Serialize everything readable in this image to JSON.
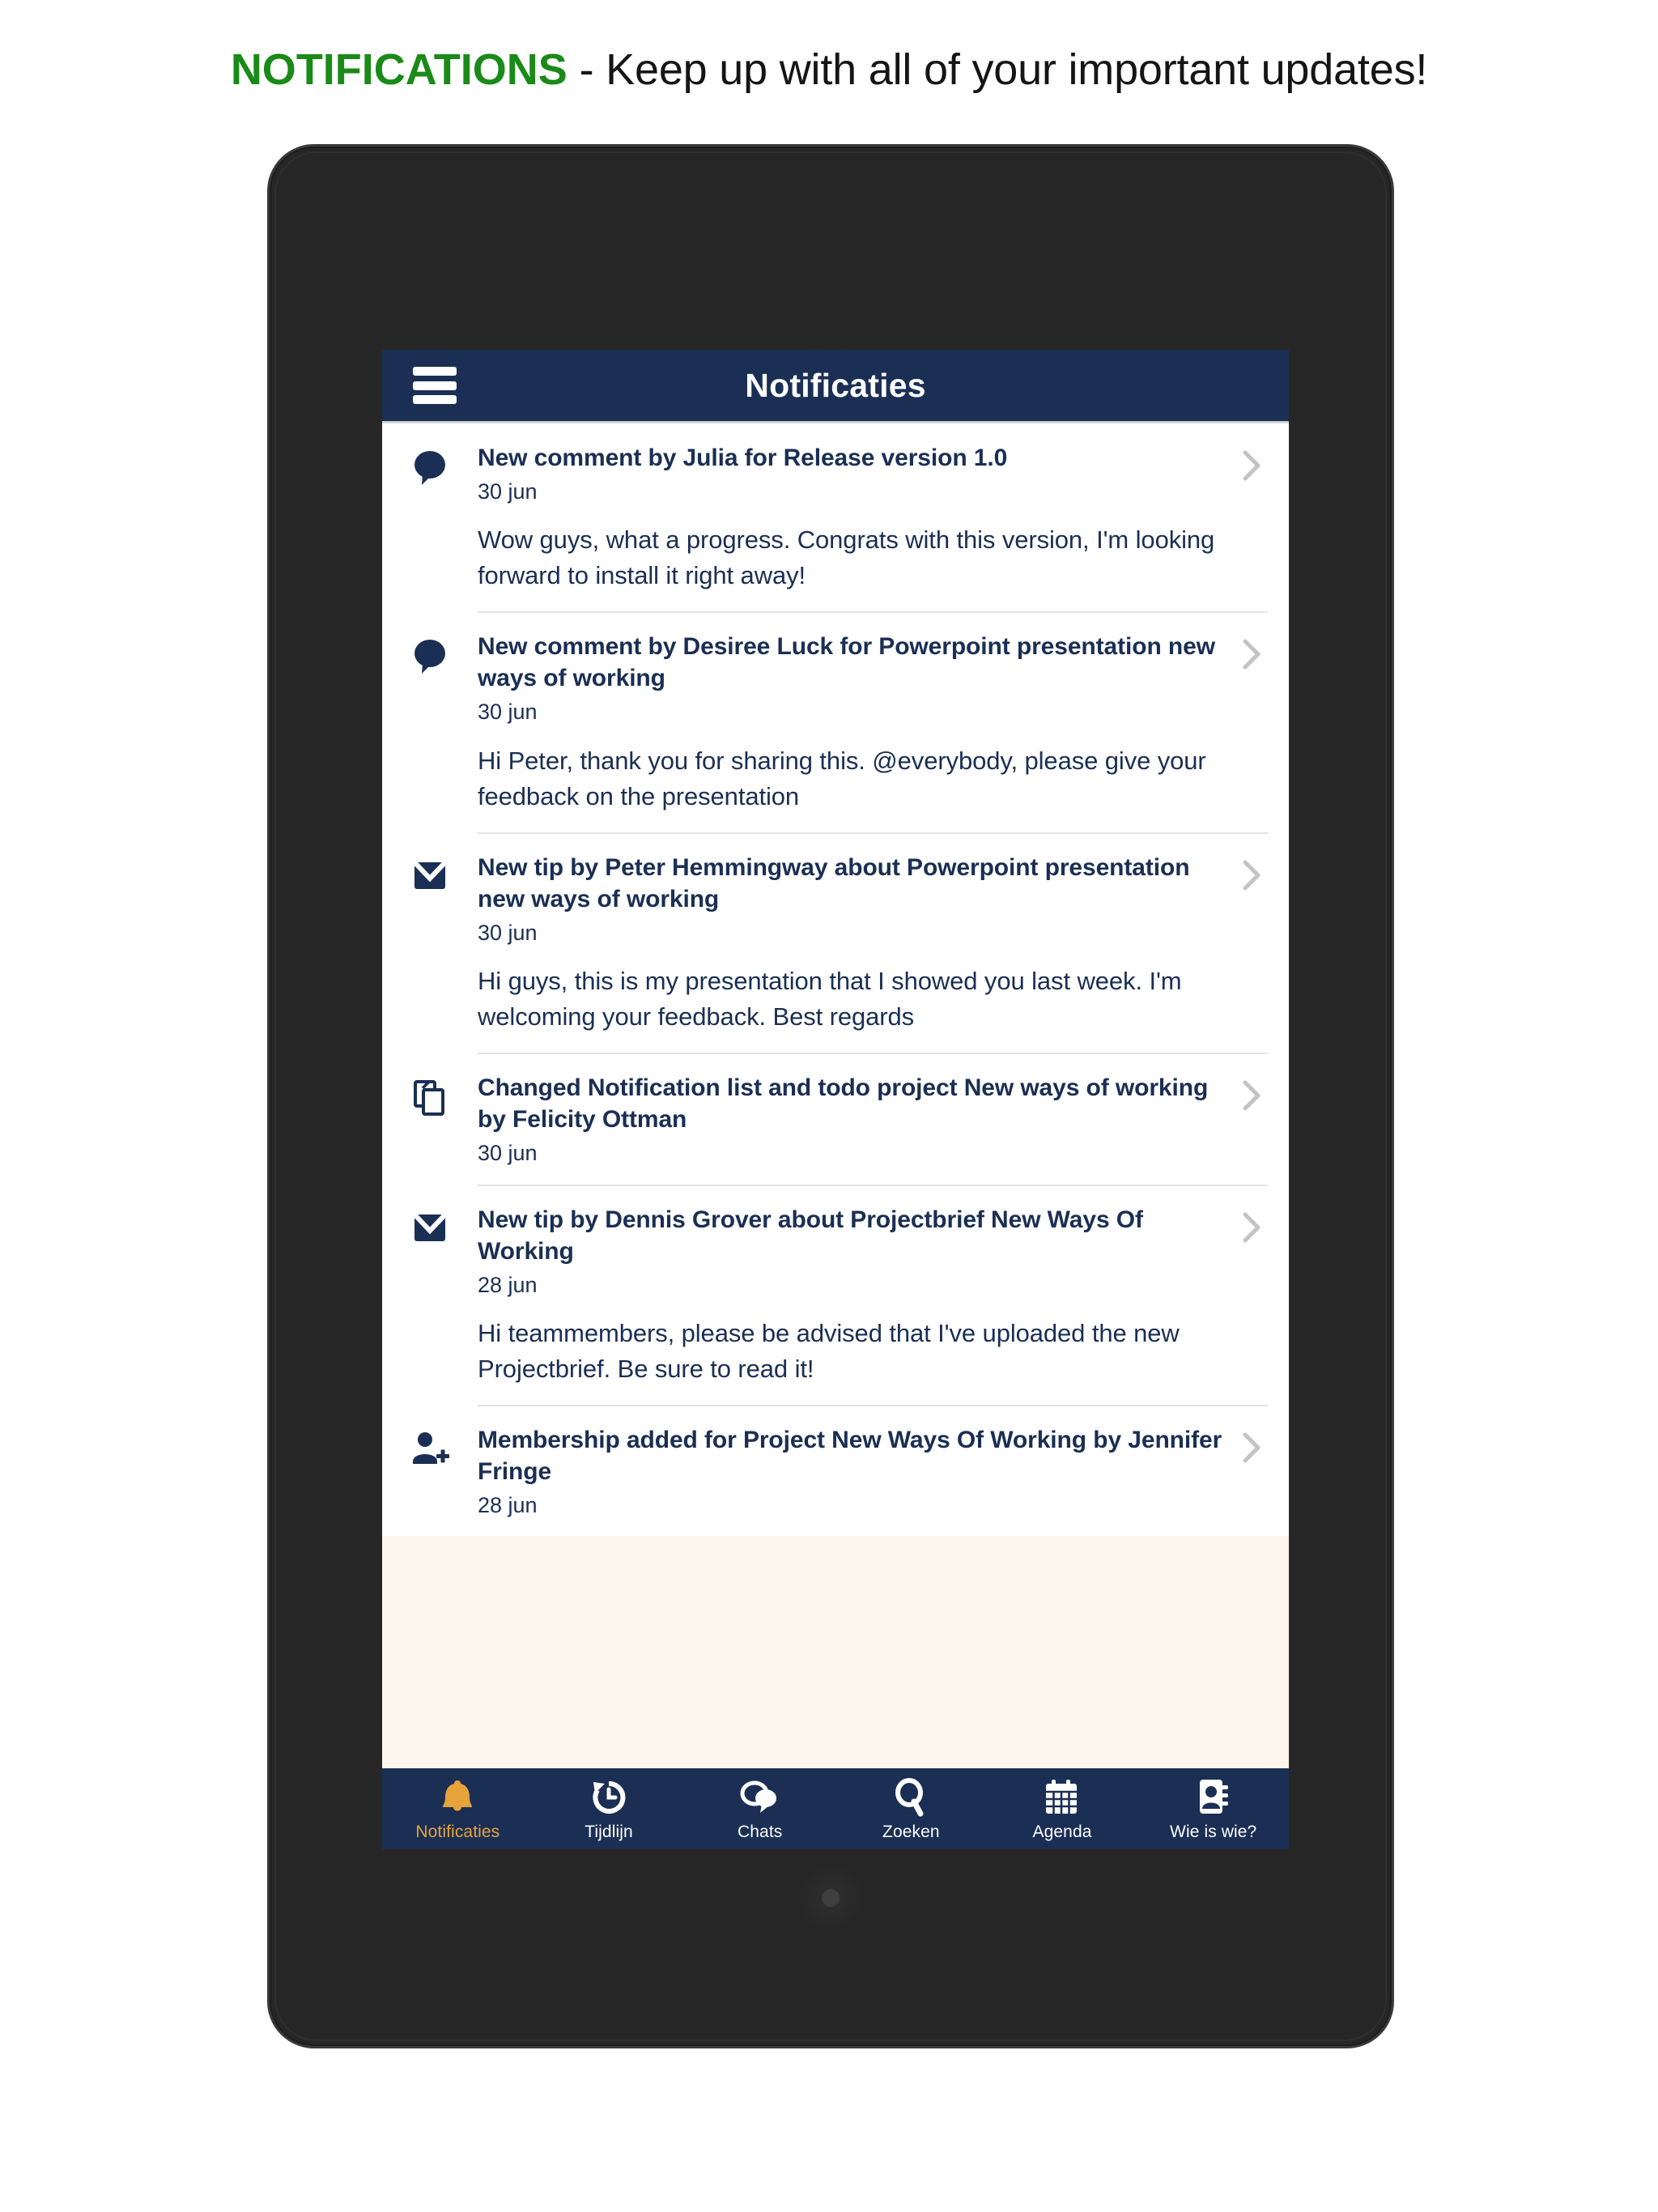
{
  "banner": {
    "keyword": "NOTIFICATIONS",
    "rest": " - Keep up with all of your important updates!"
  },
  "colors": {
    "navy": "#1b2f54",
    "accent_orange": "#e7a33c",
    "banner_green": "#1a8a18",
    "screen_bg": "#fbf4ec",
    "list_bg": "#ffffff",
    "chevron_gray": "#c0c0c0"
  },
  "app": {
    "navbar": {
      "menu_icon": "hamburger-menu-icon",
      "title": "Notificaties"
    },
    "notifications": [
      {
        "icon": "speech-bubble-icon",
        "title": "New comment by Julia for Release version 1.0",
        "date": "30 jun",
        "text": "Wow guys, what a progress. Congrats with this version, I'm looking forward to install it right away!",
        "chevron": "chevron-right-icon"
      },
      {
        "icon": "speech-bubble-icon",
        "title": "New comment by Desiree Luck for Powerpoint presentation new ways of working",
        "date": "30 jun",
        "text": "Hi Peter, thank you for sharing this. @everybody, please give your feedback on the presentation",
        "chevron": "chevron-right-icon"
      },
      {
        "icon": "envelope-icon",
        "title": "New tip by Peter Hemmingway about Powerpoint presentation new ways of working",
        "date": "30 jun",
        "text": "Hi guys, this is my presentation that I showed you last week. I'm welcoming your feedback. Best regards",
        "chevron": "chevron-right-icon"
      },
      {
        "icon": "copy-documents-icon",
        "title": "Changed Notification list and todo project New ways of working by Felicity Ottman",
        "date": "30 jun",
        "text": "",
        "chevron": "chevron-right-icon"
      },
      {
        "icon": "envelope-icon",
        "title": "New tip by Dennis Grover about Projectbrief New Ways Of Working",
        "date": "28 jun",
        "text": "Hi teammembers, please be advised that I've uploaded the new Projectbrief. Be sure to read it!",
        "chevron": "chevron-right-icon"
      },
      {
        "icon": "add-user-icon",
        "title": "Membership added for Project New Ways Of Working by Jennifer Fringe",
        "date": "28 jun",
        "text": "",
        "chevron": "chevron-right-icon"
      }
    ],
    "tabbar": [
      {
        "icon": "bell-icon",
        "label": "Notificaties",
        "active": true
      },
      {
        "icon": "history-clock-icon",
        "label": "Tijdlijn",
        "active": false
      },
      {
        "icon": "chat-bubbles-icon",
        "label": "Chats",
        "active": false
      },
      {
        "icon": "search-icon",
        "label": "Zoeken",
        "active": false
      },
      {
        "icon": "calendar-icon",
        "label": "Agenda",
        "active": false
      },
      {
        "icon": "address-book-icon",
        "label": "Wie is wie?",
        "active": false
      }
    ]
  },
  "device": {
    "camera": "front-camera",
    "home": "home-button"
  }
}
